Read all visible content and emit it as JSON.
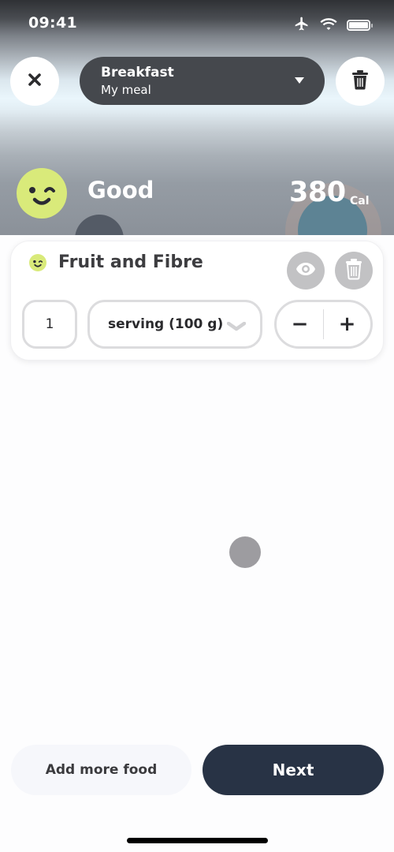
{
  "status_bar": {
    "time": "09:41",
    "icons": [
      "airplane-mode-icon",
      "wifi-icon",
      "battery-icon"
    ]
  },
  "header": {
    "close_icon": "close-icon",
    "meal_select": {
      "title": "Breakfast",
      "subtitle": "My meal",
      "caret_icon": "caret-down-icon"
    },
    "delete_icon": "trash-icon"
  },
  "summary": {
    "score_icon": "winking-face-icon",
    "score_label": "Good",
    "calories": "380",
    "calories_unit": "Cal"
  },
  "food_items": [
    {
      "name": "Fruit and Fibre",
      "score_icon": "winking-face-icon",
      "quantity": "1",
      "unit": "serving (100 g)",
      "decrement_label": "−",
      "increment_label": "+"
    }
  ],
  "actions": {
    "add_more_label": "Add more food",
    "next_label": "Next"
  },
  "colors": {
    "score_good": "#d9ea7a",
    "primary_button": "#283345",
    "meal_select_bg": "#45484d"
  }
}
